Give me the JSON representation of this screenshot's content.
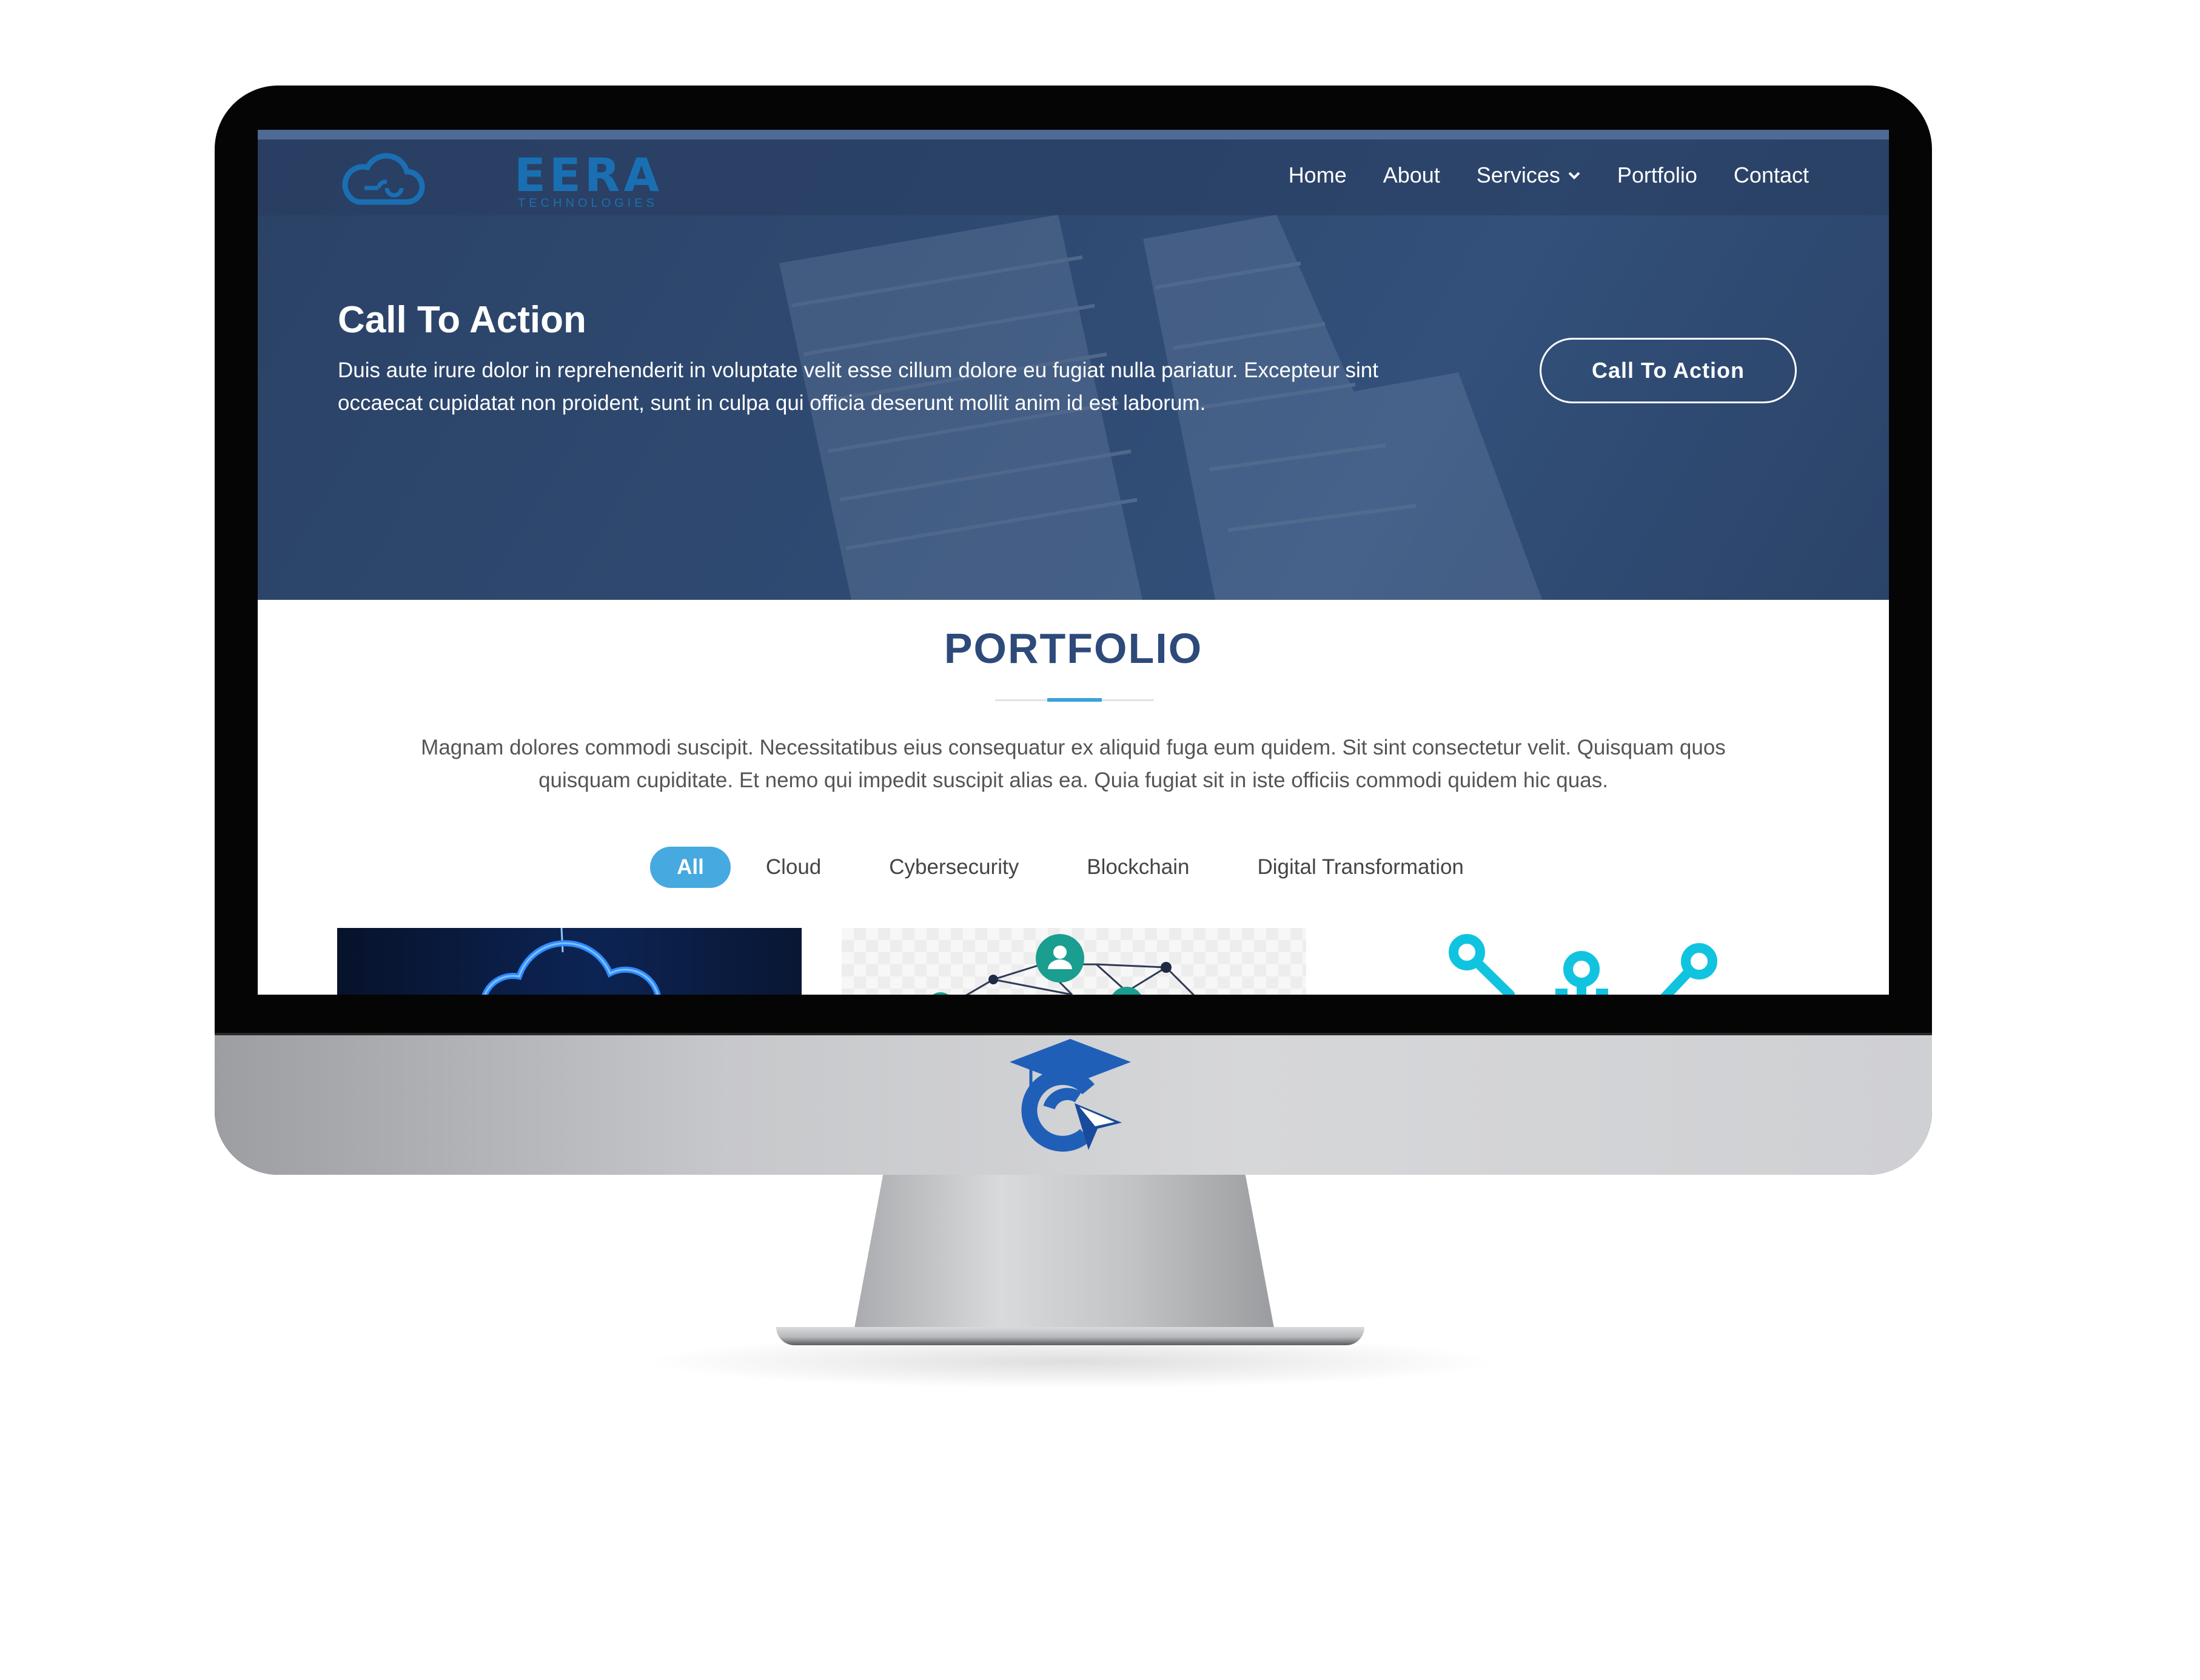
{
  "site": {
    "logo": {
      "word": "EERA",
      "sub": "TECHNOLOGIES"
    },
    "nav": [
      {
        "label": "Home"
      },
      {
        "label": "About"
      },
      {
        "label": "Services",
        "has_dropdown": true
      },
      {
        "label": "Portfolio"
      },
      {
        "label": "Contact"
      }
    ]
  },
  "hero": {
    "title": "Call To Action",
    "text": "Duis aute irure dolor in reprehenderit in voluptate velit esse cillum dolore eu fugiat nulla pariatur. Excepteur sint occaecat cupidatat non proident, sunt in culpa qui officia deserunt mollit anim id est laborum.",
    "button": "Call To Action"
  },
  "portfolio": {
    "title": "PORTFOLIO",
    "text": "Magnam dolores commodi suscipit. Necessitatibus eius consequatur ex aliquid fuga eum quidem. Sit sint consectetur velit. Quisquam quos quisquam cupiditate. Et nemo qui impedit suscipit alias ea. Quia fugiat sit in iste officiis commodi quidem hic quas.",
    "filters": [
      {
        "label": "All",
        "active": true
      },
      {
        "label": "Cloud",
        "active": false
      },
      {
        "label": "Cybersecurity",
        "active": false
      },
      {
        "label": "Blockchain",
        "active": false
      },
      {
        "label": "Digital Transformation",
        "active": false
      }
    ],
    "cards": [
      {
        "icon": "cloud-icon"
      },
      {
        "icon": "network-user-icon"
      },
      {
        "icon": "circuit-icon"
      }
    ]
  },
  "colors": {
    "hero_bg": "#2f4a72",
    "accent": "#46a9e0",
    "title": "#2d4a7a",
    "logo": "#1a6fb3"
  }
}
